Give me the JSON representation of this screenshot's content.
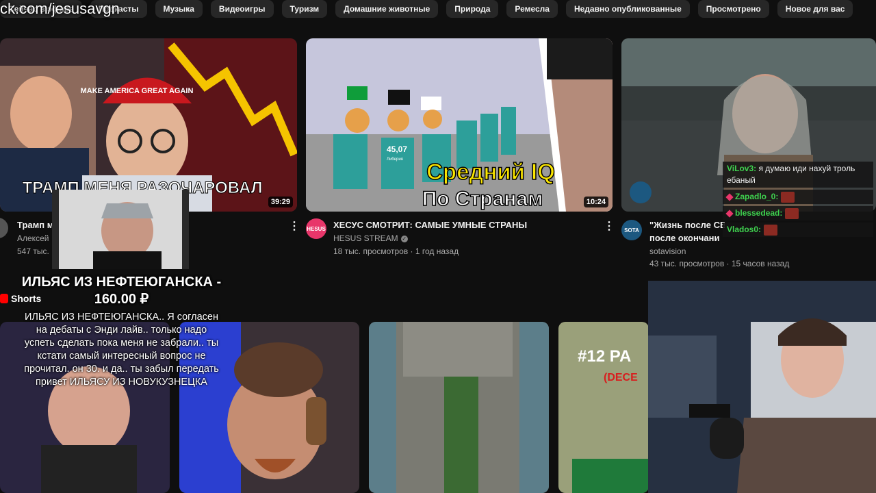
{
  "watermark": "ck.com/jesusavgn",
  "chips": [
    "Сейчас в эфире",
    "Подкасты",
    "Музыка",
    "Видеоигры",
    "Туризм",
    "Домашние животные",
    "Природа",
    "Ремесла",
    "Недавно опубликованные",
    "Просмотрено",
    "Новое для вас"
  ],
  "videos": [
    {
      "thumb_text": "ТРАМП МЕНЯ РАЗОЧАРОВАЛ",
      "thumb_hat": "MAKE AMERICA GREAT AGAIN",
      "duration": "39:29",
      "title": "Трамп м",
      "channel": "Алексей",
      "stats": "547 тыс."
    },
    {
      "thumb_text_line1": "Средний IQ",
      "thumb_text_line2": "По Странам",
      "thumb_value": "45,07",
      "thumb_country": "Либерия",
      "duration": "10:24",
      "title": "ХЕСУС СМОТРИТ: САМЫЕ УМНЫЕ СТРАНЫ",
      "channel": "HESUS STREAM",
      "avatar_text": "HESUS",
      "stats": "18 тыс. просмотров · 1 год назад"
    },
    {
      "title": "\"Жизнь после СВ",
      "title_line2": "после окончани",
      "channel": "sotavision",
      "avatar_text": "SOTA",
      "stats": "43 тыс. просмотров · 15 часов назад"
    }
  ],
  "shorts_label": "Shorts",
  "short_thumb_text": "#12 PA",
  "short_thumb_sub": "(DECE",
  "donation": {
    "title": "ИЛЬЯС ИЗ НЕФТЕЮГАНСКА - 160.00 ₽",
    "text": "ИЛЬЯС ИЗ НЕФТЕЮГАНСКА.. Я согласен на дебаты с Энди лайв.. только надо успеть сделать пока меня не забрали.. ты кстати самый интересный вопрос не прочитал. он 30. и да.. ты забыл передать привет ИЛЬЯСУ ИЗ НОВУКУЗНЕЦКА"
  },
  "chat": [
    {
      "user": "ViLov3:",
      "message": "я думаю иди нахуй троль ебаный",
      "color": "#3fd24f"
    },
    {
      "user": "Zapadlo_0:",
      "message": "",
      "color": "#3fd24f",
      "emote": true
    },
    {
      "user": "blessedead:",
      "message": "",
      "color": "#3fd24f",
      "emote": true
    },
    {
      "user": "Vlados0:",
      "message": "",
      "color": "#3fd24f",
      "emote": true
    }
  ],
  "colors": {
    "accent": "#ff0000",
    "background": "#0f0f0f",
    "chip": "#272727"
  }
}
